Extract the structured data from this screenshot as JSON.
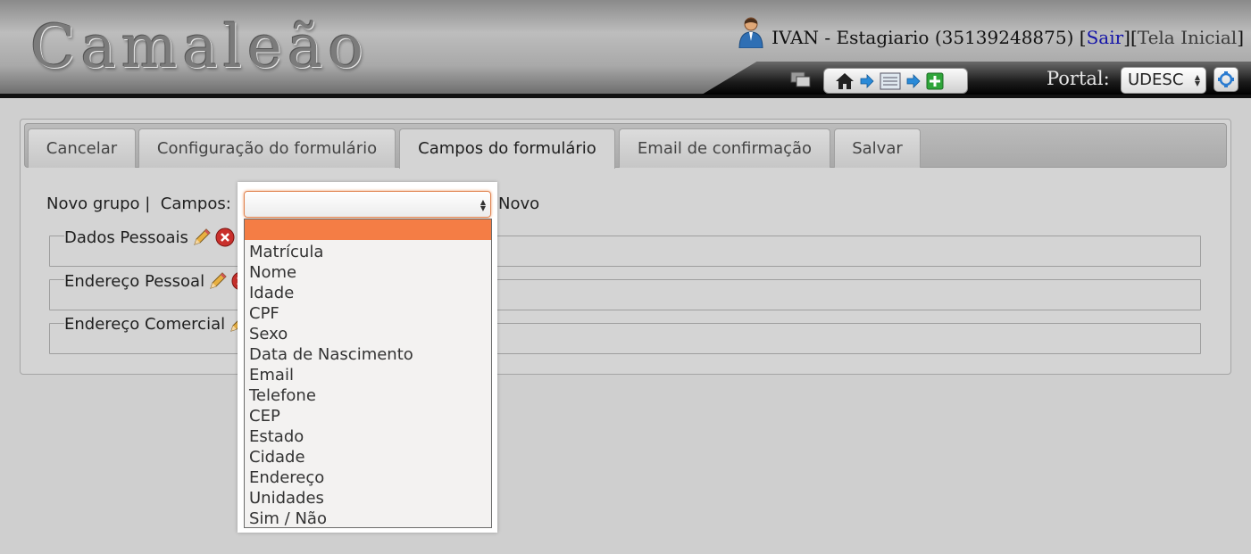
{
  "header": {
    "logo": "Camaleão",
    "user_name": "IVAN - Estagiario (35139248875)",
    "bracket_open": "[",
    "logout_label": "Sair",
    "bracket_mid": "][",
    "home_label": "Tela Inicial",
    "bracket_close": "]",
    "portal_label": "Portal:",
    "portal_value": "UDESC"
  },
  "tabs": [
    {
      "label": "Cancelar"
    },
    {
      "label": "Configuração do formulário"
    },
    {
      "label": "Campos do formulário",
      "active": true
    },
    {
      "label": "Email de confirmação"
    },
    {
      "label": "Salvar"
    }
  ],
  "form": {
    "new_group_label": "Novo grupo |",
    "fields_label": "Campos:",
    "new_label": "Novo",
    "select_value": ""
  },
  "groups": [
    {
      "name": "Dados Pessoais"
    },
    {
      "name": "Endereço Pessoal"
    },
    {
      "name": "Endereço Comercial"
    }
  ],
  "dropdown_options": [
    "",
    "Matrícula",
    "Nome",
    "Idade",
    "CPF",
    "Sexo",
    "Data de Nascimento",
    "Email",
    "Telefone",
    "CEP",
    "Estado",
    "Cidade",
    "Endereço",
    "Unidades",
    "Sim / Não"
  ],
  "colors": {
    "highlight": "#f47d45",
    "link": "#1414a8",
    "header_bar": "#111111"
  }
}
